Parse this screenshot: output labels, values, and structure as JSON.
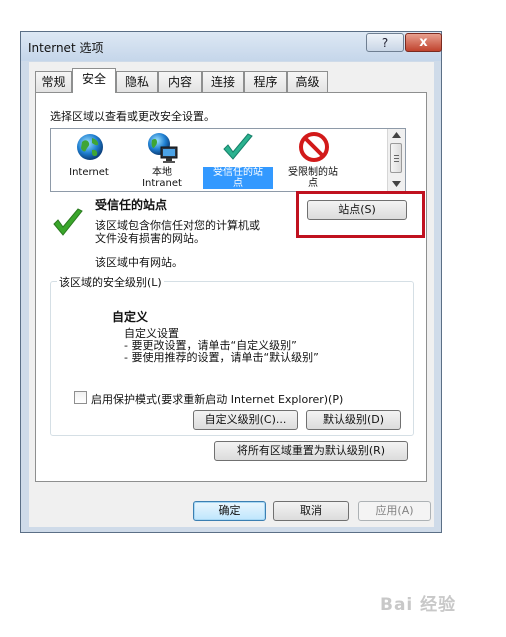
{
  "window": {
    "title": "Internet 选项",
    "help_label": "?",
    "close_label": "x"
  },
  "tabs": [
    "常规",
    "安全",
    "隐私",
    "内容",
    "连接",
    "程序",
    "高级"
  ],
  "active_tab": "安全",
  "security": {
    "select_zone_label": "选择区域以查看或更改安全设置。",
    "zones": [
      "Internet",
      "本地\nIntranet",
      "受信任的站\n点",
      "受限制的站\n点"
    ],
    "zone_title": "受信任的站点",
    "zone_desc_line1": "该区域包含你信任对您的计算机或",
    "zone_desc_line2": "文件没有损害的网站。",
    "zone_sites_note": "该区域中有网站。",
    "sites_button": "站点(S)",
    "level_group_label": "该区域的安全级别(L)",
    "custom_title": "自定义",
    "custom_line1": "自定义设置",
    "custom_line2": "- 要更改设置，请单击“自定义级别”",
    "custom_line3": "- 要使用推荐的设置，请单击“默认级别”",
    "protected_mode_label": "启用保护模式(要求重新启动 Internet Explorer)(P)",
    "protected_mode_checked": false,
    "custom_level_button": "自定义级别(C)...",
    "default_level_button": "默认级别(D)",
    "reset_all_button": "将所有区域重置为默认级别(R)"
  },
  "footer": {
    "ok_button": "确定",
    "cancel_button": "取消",
    "apply_button": "应用(A)"
  },
  "watermark": "Bai 经验",
  "colors": {
    "selection": "#3399ff",
    "highlight_box": "#c0111f",
    "check_green": "#3aa62b",
    "restricted_red": "#d21a1a"
  }
}
